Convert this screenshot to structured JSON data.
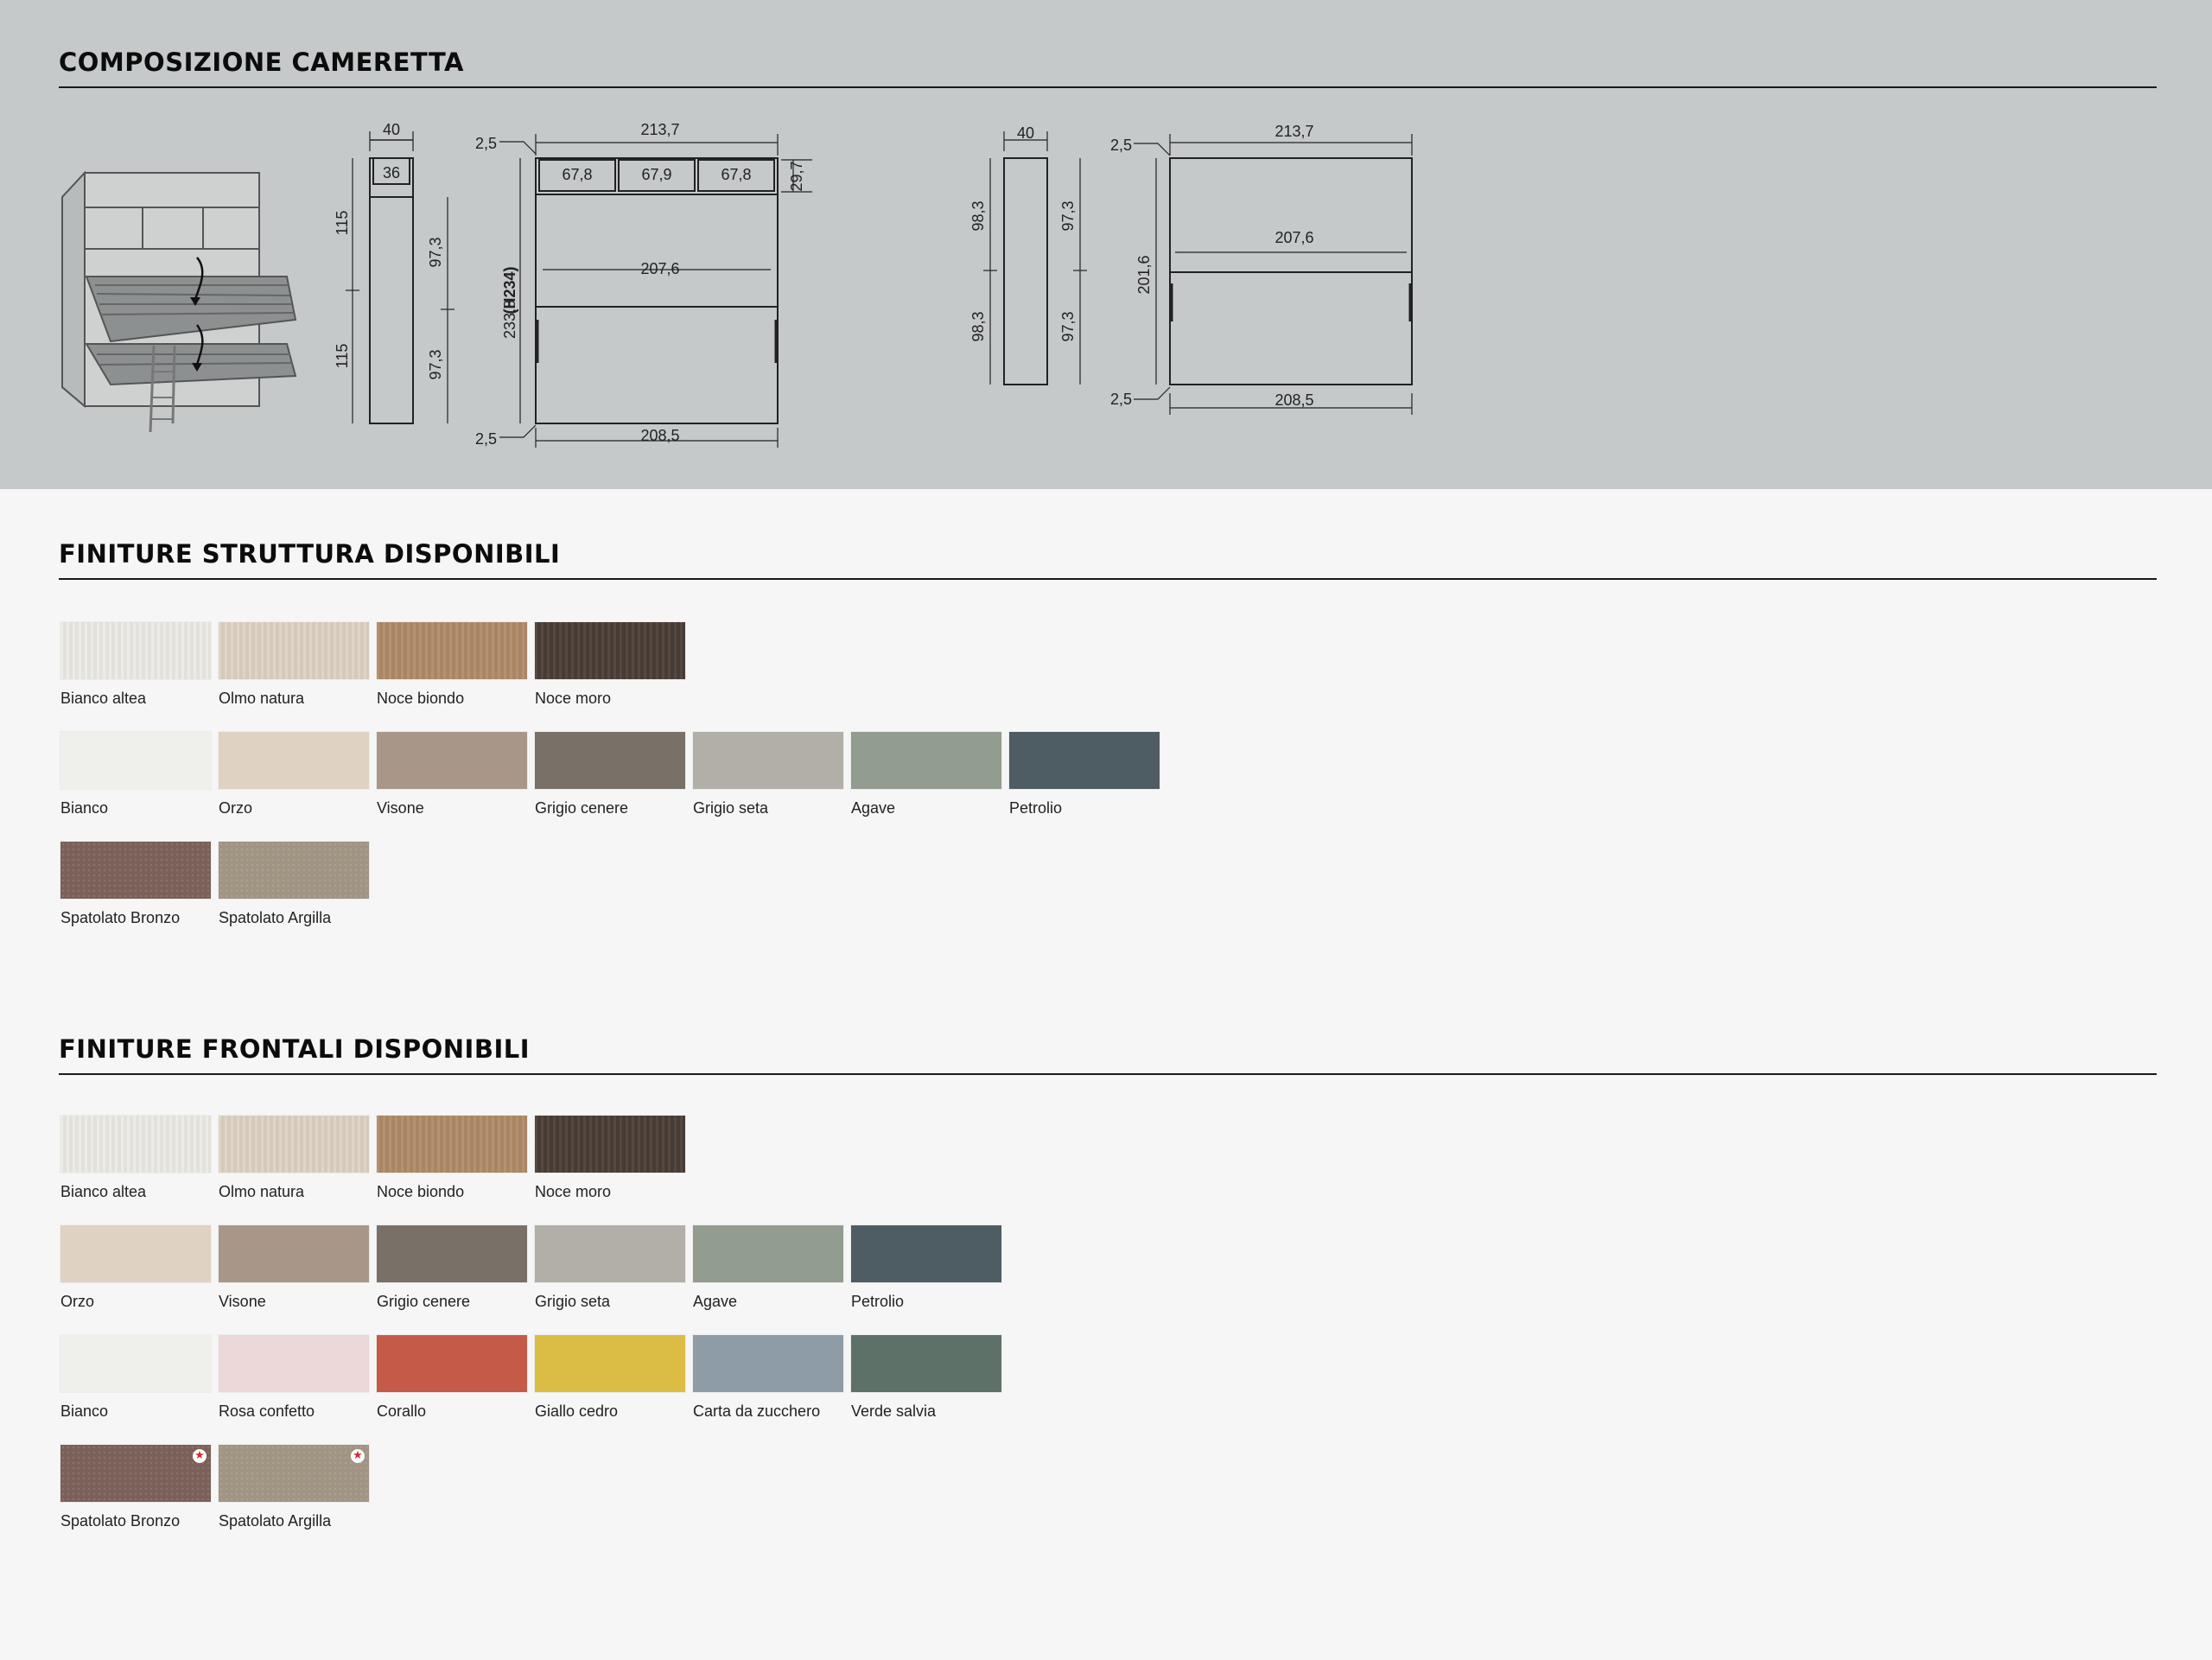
{
  "sections": {
    "composition": {
      "title": "COMPOSIZIONE CAMERETTA"
    },
    "structure": {
      "title": "FINITURE STRUTTURA DISPONIBILI"
    },
    "fronts": {
      "title": "FINITURE FRONTALI DISPONIBILI"
    }
  },
  "drawing": {
    "side1": {
      "top": "40",
      "inner": "36",
      "h_upper": "115",
      "h_lower": "115",
      "d_upper": "97,3",
      "d_lower": "97,3"
    },
    "front1": {
      "width": "213,7",
      "margin_top": "2,5",
      "margin_bottom": "2,5",
      "col1": "67,8",
      "col2": "67,9",
      "col3": "67,8",
      "shelf_h": "29,7",
      "inner_w": "207,6",
      "height": "233,8",
      "height_code": "(H234)",
      "base_w": "208,5"
    },
    "side2": {
      "top": "40",
      "h_upper": "98,3",
      "h_lower": "98,3",
      "d_upper": "97,3",
      "d_lower": "97,3"
    },
    "front2": {
      "width": "213,7",
      "margin_top": "2,5",
      "margin_bottom": "2,5",
      "inner_w": "207,6",
      "height": "201,6",
      "base_w": "208,5"
    }
  },
  "structure_finishes": [
    [
      {
        "label": "Bianco altea",
        "color": "#eceae4",
        "texture": "wood"
      },
      {
        "label": "Olmo natura",
        "color": "#ddd2c3",
        "texture": "wood"
      },
      {
        "label": "Noce biondo",
        "color": "#b08a67",
        "texture": "wood"
      },
      {
        "label": "Noce moro",
        "color": "#4a3d36",
        "texture": "wood"
      }
    ],
    [
      {
        "label": "Bianco",
        "color": "#efefeb"
      },
      {
        "label": "Orzo",
        "color": "#e0d2c2"
      },
      {
        "label": "Visone",
        "color": "#a89789"
      },
      {
        "label": "Grigio cenere",
        "color": "#797067"
      },
      {
        "label": "Grigio seta",
        "color": "#b2aea8"
      },
      {
        "label": "Agave",
        "color": "#929c8f"
      },
      {
        "label": "Petrolio",
        "color": "#4e5d64"
      }
    ],
    [
      {
        "label": "Spatolato Bronzo",
        "color": "#7a6058",
        "texture": "spat"
      },
      {
        "label": "Spatolato Argilla",
        "color": "#a09483",
        "texture": "spat"
      }
    ]
  ],
  "front_finishes": [
    [
      {
        "label": "Bianco altea",
        "color": "#eceae4",
        "texture": "wood"
      },
      {
        "label": "Olmo natura",
        "color": "#ddd2c3",
        "texture": "wood"
      },
      {
        "label": "Noce biondo",
        "color": "#b08a67",
        "texture": "wood"
      },
      {
        "label": "Noce moro",
        "color": "#4a3d36",
        "texture": "wood"
      }
    ],
    [
      {
        "label": "Orzo",
        "color": "#e0d2c2"
      },
      {
        "label": "Visone",
        "color": "#a89789"
      },
      {
        "label": "Grigio cenere",
        "color": "#797067"
      },
      {
        "label": "Grigio seta",
        "color": "#b2aea8"
      },
      {
        "label": "Agave",
        "color": "#929c8f"
      },
      {
        "label": "Petrolio",
        "color": "#4e5d64"
      }
    ],
    [
      {
        "label": "Bianco",
        "color": "#efefeb"
      },
      {
        "label": "Rosa confetto",
        "color": "#ecd7d9"
      },
      {
        "label": "Corallo",
        "color": "#c55a48"
      },
      {
        "label": "Giallo cedro",
        "color": "#dbbd45"
      },
      {
        "label": "Carta da zucchero",
        "color": "#8d9ca6"
      },
      {
        "label": "Verde salvia",
        "color": "#5e7169"
      }
    ],
    [
      {
        "label": "Spatolato Bronzo",
        "color": "#7a6058",
        "texture": "spat",
        "badge": "★"
      },
      {
        "label": "Spatolato Argilla",
        "color": "#a09483",
        "texture": "spat",
        "badge": "★"
      }
    ]
  ]
}
